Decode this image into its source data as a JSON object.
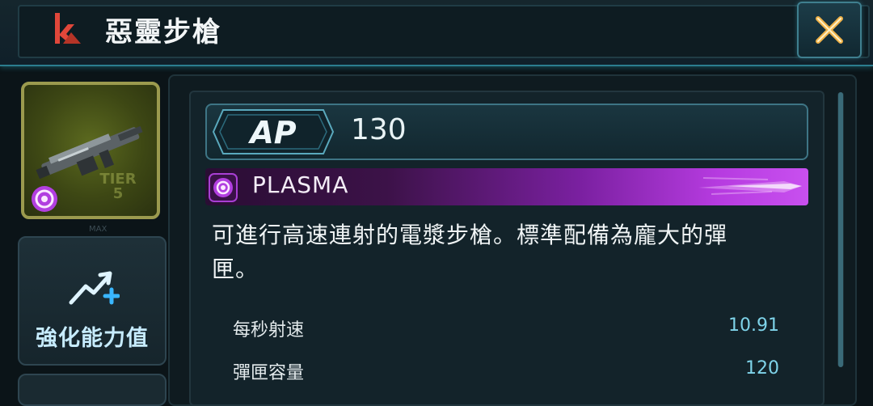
{
  "header": {
    "title": "惡靈步槍",
    "brand_icon": "faction-emblem-icon",
    "close_icon": "close-x-icon"
  },
  "weapon": {
    "tile_icon": "rifle-image",
    "tier_text": "TIER 5",
    "element_icon": "plasma-icon",
    "max_label": "MAX"
  },
  "sidebar": {
    "enhance_label": "強化能力值",
    "enhance_icon": "stat-upgrade-icon"
  },
  "details": {
    "ap_label": "AP",
    "ap_value": "130",
    "element_label": "PLASMA",
    "description": "可進行高速連射的電漿步槍。標準配備為龐大的彈匣。",
    "stats": [
      {
        "label": "每秒射速",
        "value": "10.91"
      },
      {
        "label": "彈匣容量",
        "value": "120"
      }
    ]
  },
  "colors": {
    "accent": "#3e7585",
    "plasma": "#c850ef",
    "close_gold": "#f0b34a",
    "stat_value": "#7fd4ea"
  }
}
